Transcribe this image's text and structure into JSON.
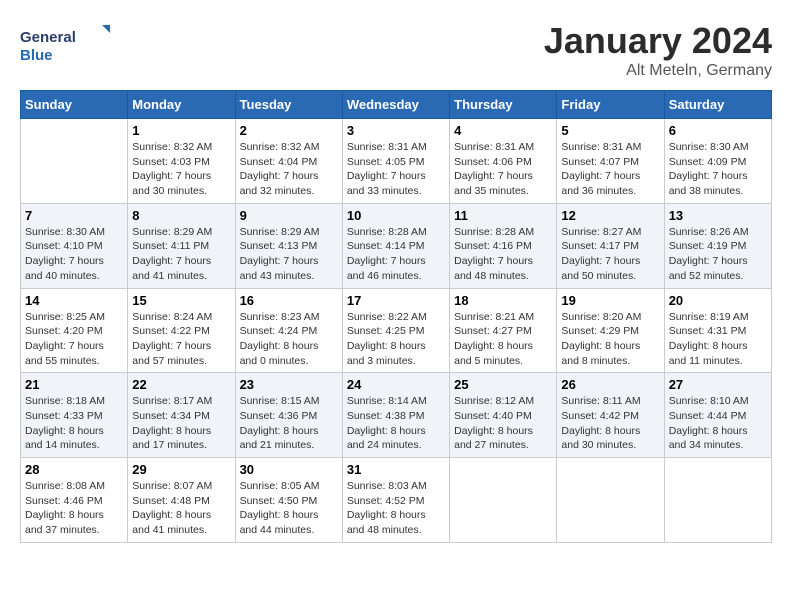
{
  "header": {
    "logo_general": "General",
    "logo_blue": "Blue",
    "title": "January 2024",
    "subtitle": "Alt Meteln, Germany"
  },
  "weekdays": [
    "Sunday",
    "Monday",
    "Tuesday",
    "Wednesday",
    "Thursday",
    "Friday",
    "Saturday"
  ],
  "weeks": [
    [
      {
        "day": "",
        "sunrise": "",
        "sunset": "",
        "daylight": ""
      },
      {
        "day": "1",
        "sunrise": "Sunrise: 8:32 AM",
        "sunset": "Sunset: 4:03 PM",
        "daylight": "Daylight: 7 hours and 30 minutes."
      },
      {
        "day": "2",
        "sunrise": "Sunrise: 8:32 AM",
        "sunset": "Sunset: 4:04 PM",
        "daylight": "Daylight: 7 hours and 32 minutes."
      },
      {
        "day": "3",
        "sunrise": "Sunrise: 8:31 AM",
        "sunset": "Sunset: 4:05 PM",
        "daylight": "Daylight: 7 hours and 33 minutes."
      },
      {
        "day": "4",
        "sunrise": "Sunrise: 8:31 AM",
        "sunset": "Sunset: 4:06 PM",
        "daylight": "Daylight: 7 hours and 35 minutes."
      },
      {
        "day": "5",
        "sunrise": "Sunrise: 8:31 AM",
        "sunset": "Sunset: 4:07 PM",
        "daylight": "Daylight: 7 hours and 36 minutes."
      },
      {
        "day": "6",
        "sunrise": "Sunrise: 8:30 AM",
        "sunset": "Sunset: 4:09 PM",
        "daylight": "Daylight: 7 hours and 38 minutes."
      }
    ],
    [
      {
        "day": "7",
        "sunrise": "Sunrise: 8:30 AM",
        "sunset": "Sunset: 4:10 PM",
        "daylight": "Daylight: 7 hours and 40 minutes."
      },
      {
        "day": "8",
        "sunrise": "Sunrise: 8:29 AM",
        "sunset": "Sunset: 4:11 PM",
        "daylight": "Daylight: 7 hours and 41 minutes."
      },
      {
        "day": "9",
        "sunrise": "Sunrise: 8:29 AM",
        "sunset": "Sunset: 4:13 PM",
        "daylight": "Daylight: 7 hours and 43 minutes."
      },
      {
        "day": "10",
        "sunrise": "Sunrise: 8:28 AM",
        "sunset": "Sunset: 4:14 PM",
        "daylight": "Daylight: 7 hours and 46 minutes."
      },
      {
        "day": "11",
        "sunrise": "Sunrise: 8:28 AM",
        "sunset": "Sunset: 4:16 PM",
        "daylight": "Daylight: 7 hours and 48 minutes."
      },
      {
        "day": "12",
        "sunrise": "Sunrise: 8:27 AM",
        "sunset": "Sunset: 4:17 PM",
        "daylight": "Daylight: 7 hours and 50 minutes."
      },
      {
        "day": "13",
        "sunrise": "Sunrise: 8:26 AM",
        "sunset": "Sunset: 4:19 PM",
        "daylight": "Daylight: 7 hours and 52 minutes."
      }
    ],
    [
      {
        "day": "14",
        "sunrise": "Sunrise: 8:25 AM",
        "sunset": "Sunset: 4:20 PM",
        "daylight": "Daylight: 7 hours and 55 minutes."
      },
      {
        "day": "15",
        "sunrise": "Sunrise: 8:24 AM",
        "sunset": "Sunset: 4:22 PM",
        "daylight": "Daylight: 7 hours and 57 minutes."
      },
      {
        "day": "16",
        "sunrise": "Sunrise: 8:23 AM",
        "sunset": "Sunset: 4:24 PM",
        "daylight": "Daylight: 8 hours and 0 minutes."
      },
      {
        "day": "17",
        "sunrise": "Sunrise: 8:22 AM",
        "sunset": "Sunset: 4:25 PM",
        "daylight": "Daylight: 8 hours and 3 minutes."
      },
      {
        "day": "18",
        "sunrise": "Sunrise: 8:21 AM",
        "sunset": "Sunset: 4:27 PM",
        "daylight": "Daylight: 8 hours and 5 minutes."
      },
      {
        "day": "19",
        "sunrise": "Sunrise: 8:20 AM",
        "sunset": "Sunset: 4:29 PM",
        "daylight": "Daylight: 8 hours and 8 minutes."
      },
      {
        "day": "20",
        "sunrise": "Sunrise: 8:19 AM",
        "sunset": "Sunset: 4:31 PM",
        "daylight": "Daylight: 8 hours and 11 minutes."
      }
    ],
    [
      {
        "day": "21",
        "sunrise": "Sunrise: 8:18 AM",
        "sunset": "Sunset: 4:33 PM",
        "daylight": "Daylight: 8 hours and 14 minutes."
      },
      {
        "day": "22",
        "sunrise": "Sunrise: 8:17 AM",
        "sunset": "Sunset: 4:34 PM",
        "daylight": "Daylight: 8 hours and 17 minutes."
      },
      {
        "day": "23",
        "sunrise": "Sunrise: 8:15 AM",
        "sunset": "Sunset: 4:36 PM",
        "daylight": "Daylight: 8 hours and 21 minutes."
      },
      {
        "day": "24",
        "sunrise": "Sunrise: 8:14 AM",
        "sunset": "Sunset: 4:38 PM",
        "daylight": "Daylight: 8 hours and 24 minutes."
      },
      {
        "day": "25",
        "sunrise": "Sunrise: 8:12 AM",
        "sunset": "Sunset: 4:40 PM",
        "daylight": "Daylight: 8 hours and 27 minutes."
      },
      {
        "day": "26",
        "sunrise": "Sunrise: 8:11 AM",
        "sunset": "Sunset: 4:42 PM",
        "daylight": "Daylight: 8 hours and 30 minutes."
      },
      {
        "day": "27",
        "sunrise": "Sunrise: 8:10 AM",
        "sunset": "Sunset: 4:44 PM",
        "daylight": "Daylight: 8 hours and 34 minutes."
      }
    ],
    [
      {
        "day": "28",
        "sunrise": "Sunrise: 8:08 AM",
        "sunset": "Sunset: 4:46 PM",
        "daylight": "Daylight: 8 hours and 37 minutes."
      },
      {
        "day": "29",
        "sunrise": "Sunrise: 8:07 AM",
        "sunset": "Sunset: 4:48 PM",
        "daylight": "Daylight: 8 hours and 41 minutes."
      },
      {
        "day": "30",
        "sunrise": "Sunrise: 8:05 AM",
        "sunset": "Sunset: 4:50 PM",
        "daylight": "Daylight: 8 hours and 44 minutes."
      },
      {
        "day": "31",
        "sunrise": "Sunrise: 8:03 AM",
        "sunset": "Sunset: 4:52 PM",
        "daylight": "Daylight: 8 hours and 48 minutes."
      },
      {
        "day": "",
        "sunrise": "",
        "sunset": "",
        "daylight": ""
      },
      {
        "day": "",
        "sunrise": "",
        "sunset": "",
        "daylight": ""
      },
      {
        "day": "",
        "sunrise": "",
        "sunset": "",
        "daylight": ""
      }
    ]
  ]
}
